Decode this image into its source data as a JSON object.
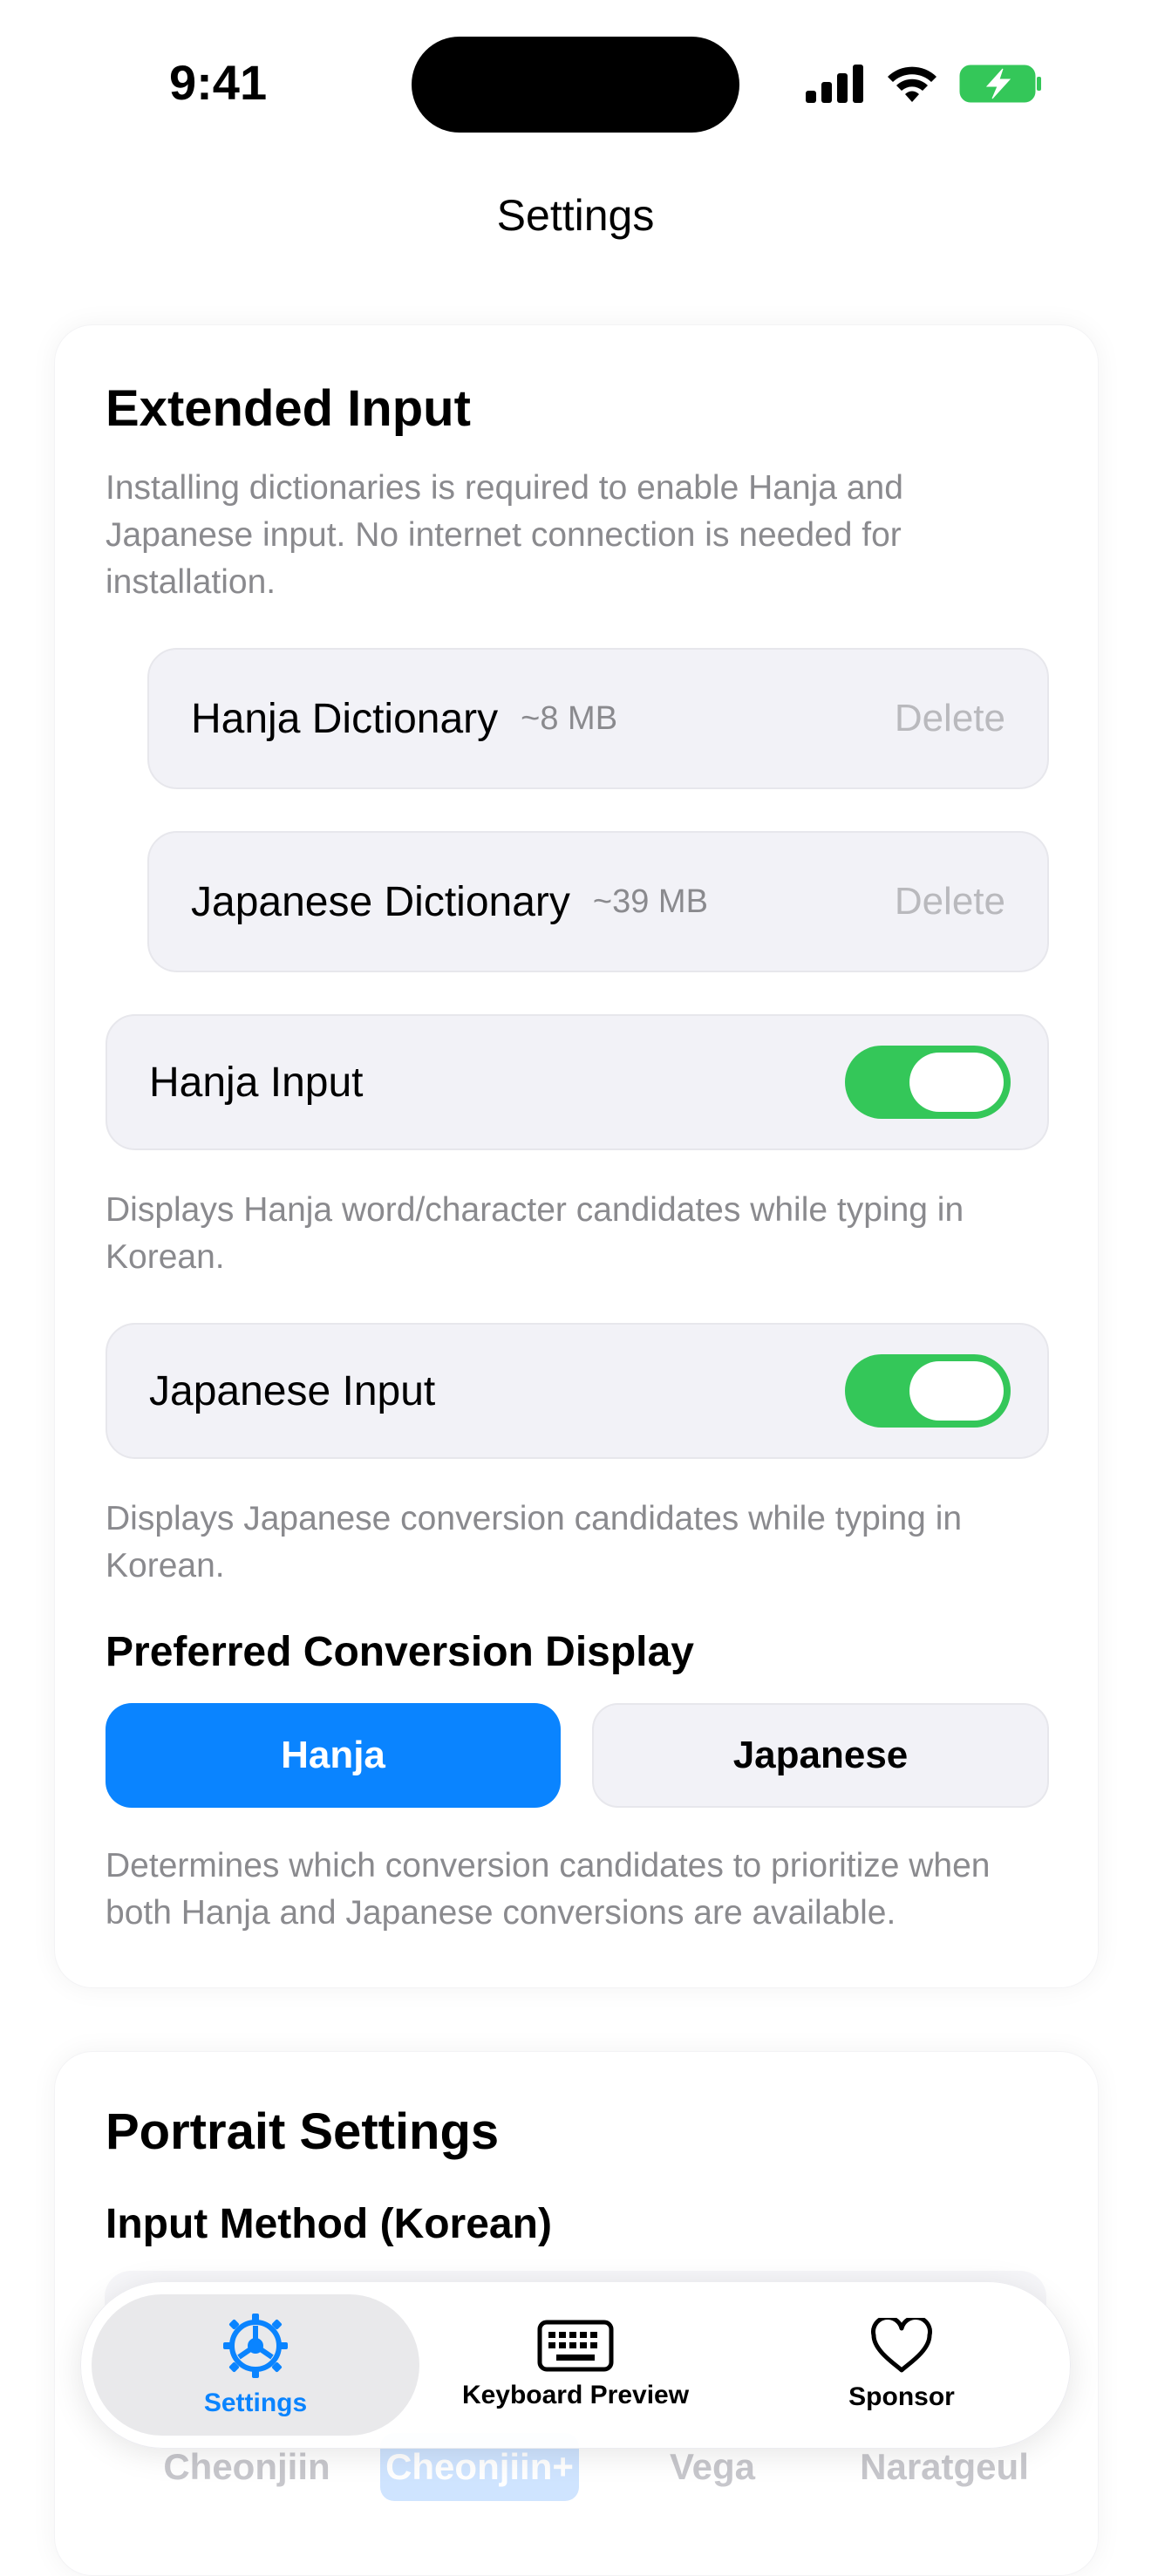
{
  "status": {
    "time": "9:41"
  },
  "nav": {
    "title": "Settings"
  },
  "extended_input": {
    "heading": "Extended Input",
    "description": "Installing dictionaries is required to enable Hanja and Japanese input. No internet connection is needed for installation.",
    "dictionaries": [
      {
        "name": "Hanja Dictionary",
        "size": "~8 MB",
        "action": "Delete"
      },
      {
        "name": "Japanese Dictionary",
        "size": "~39 MB",
        "action": "Delete"
      }
    ],
    "hanja_input": {
      "label": "Hanja Input",
      "enabled": true,
      "description": "Displays Hanja word/character candidates while typing in Korean."
    },
    "japanese_input": {
      "label": "Japanese Input",
      "enabled": true,
      "description": "Displays Japanese conversion candidates while typing in Korean."
    },
    "preferred": {
      "heading": "Preferred Conversion Display",
      "options": [
        "Hanja",
        "Japanese"
      ],
      "selected": "Hanja",
      "description": "Determines which conversion candidates to prioritize when both Hanja and Japanese conversions are available."
    }
  },
  "portrait": {
    "heading": "Portrait Settings",
    "input_method_label": "Input Method (Korean)",
    "layouts": [
      "Cheonjiin",
      "Cheonjiin+",
      "Vega",
      "Naratgeul"
    ]
  },
  "tabbar": {
    "tabs": [
      {
        "label": "Settings",
        "icon": "gear-icon",
        "selected": true
      },
      {
        "label": "Keyboard Preview",
        "icon": "keyboard-icon",
        "selected": false
      },
      {
        "label": "Sponsor",
        "icon": "heart-icon",
        "selected": false
      }
    ]
  },
  "colors": {
    "accent": "#0a84ff",
    "toggle_on": "#34c759",
    "row_bg": "#f2f2f7",
    "secondary_text": "#8a8a8e"
  }
}
